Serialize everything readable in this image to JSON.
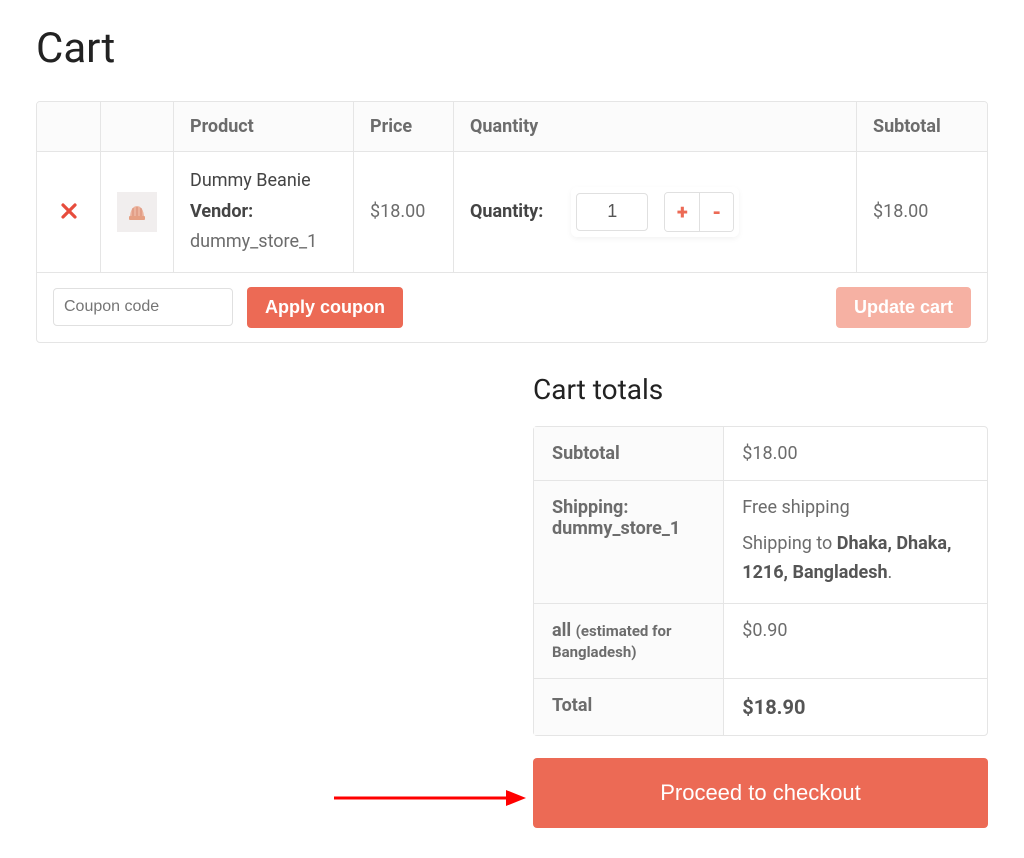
{
  "page": {
    "title": "Cart"
  },
  "table": {
    "headers": {
      "product": "Product",
      "price": "Price",
      "quantity": "Quantity",
      "subtotal": "Subtotal"
    }
  },
  "items": [
    {
      "name": "Dummy Beanie",
      "vendor_label": "Vendor:",
      "vendor": "dummy_store_1",
      "price": "$18.00",
      "qty_label": "Quantity:",
      "qty": "1",
      "subtotal": "$18.00"
    }
  ],
  "coupon": {
    "placeholder": "Coupon code",
    "apply_label": "Apply coupon"
  },
  "update_label": "Update cart",
  "totals": {
    "title": "Cart totals",
    "subtotal_label": "Subtotal",
    "subtotal": "$18.00",
    "shipping_label": "Shipping: dummy_store_1",
    "shipping_method": "Free shipping",
    "shipping_to_prefix": "Shipping to ",
    "shipping_to_bold": "Dhaka, Dhaka, 1216, Bangladesh",
    "shipping_to_suffix": ".",
    "tax_label_main": "all ",
    "tax_label_note": "(estimated for Bangladesh)",
    "tax": "$0.90",
    "total_label": "Total",
    "total": "$18.90"
  },
  "checkout_label": "Proceed to checkout",
  "colors": {
    "accent": "#ec6a55"
  }
}
